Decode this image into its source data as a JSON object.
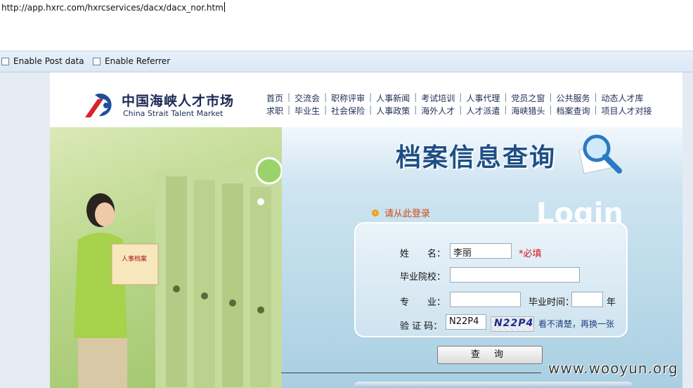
{
  "url_bar": {
    "text": "http://app.hxrc.com/hxrcservices/dacx/dacx_nor.htm"
  },
  "options": [
    {
      "label": "Enable Post data",
      "checked": false
    },
    {
      "label": "Enable Referrer",
      "checked": false
    }
  ],
  "header": {
    "logo_cn": "中国海峡人才市场",
    "logo_en": "China Strait Talent Market",
    "nav_row_1": [
      "首页",
      "交流会",
      "职称评审",
      "人事新闻",
      "考试培训",
      "人事代理",
      "党员之窗",
      "公共服务",
      "动态人才库"
    ],
    "nav_row_2": [
      "求职",
      "毕业生",
      "社会保险",
      "人事政策",
      "海外人才",
      "人才派遣",
      "海峡猎头",
      "档案查询",
      "项目人才对接"
    ]
  },
  "banner": {
    "title": "档案信息查询",
    "login_word": "Login",
    "prompt": "请从此登录",
    "folder_label": "人事档案"
  },
  "form": {
    "name_label": "姓　　名：",
    "name_value": "李丽",
    "required": "*必填",
    "school_label": "毕业院校：",
    "school_value": "",
    "major_label": "专　　业：",
    "major_value": "",
    "grad_time_label": "毕业时间：",
    "grad_time_value": "",
    "year_suffix": "年",
    "captcha_label": "验 证 码：",
    "captcha_value": "N22P4",
    "captcha_image_text": "N22P4",
    "refresh_text": "看不清楚，再换一张",
    "submit_label": "查 询"
  },
  "watermark": "www.wooyun.org",
  "colors": {
    "accent_blue": "#1d4f86",
    "required_red": "#d9141d",
    "prompt_orange": "#d24a12"
  }
}
